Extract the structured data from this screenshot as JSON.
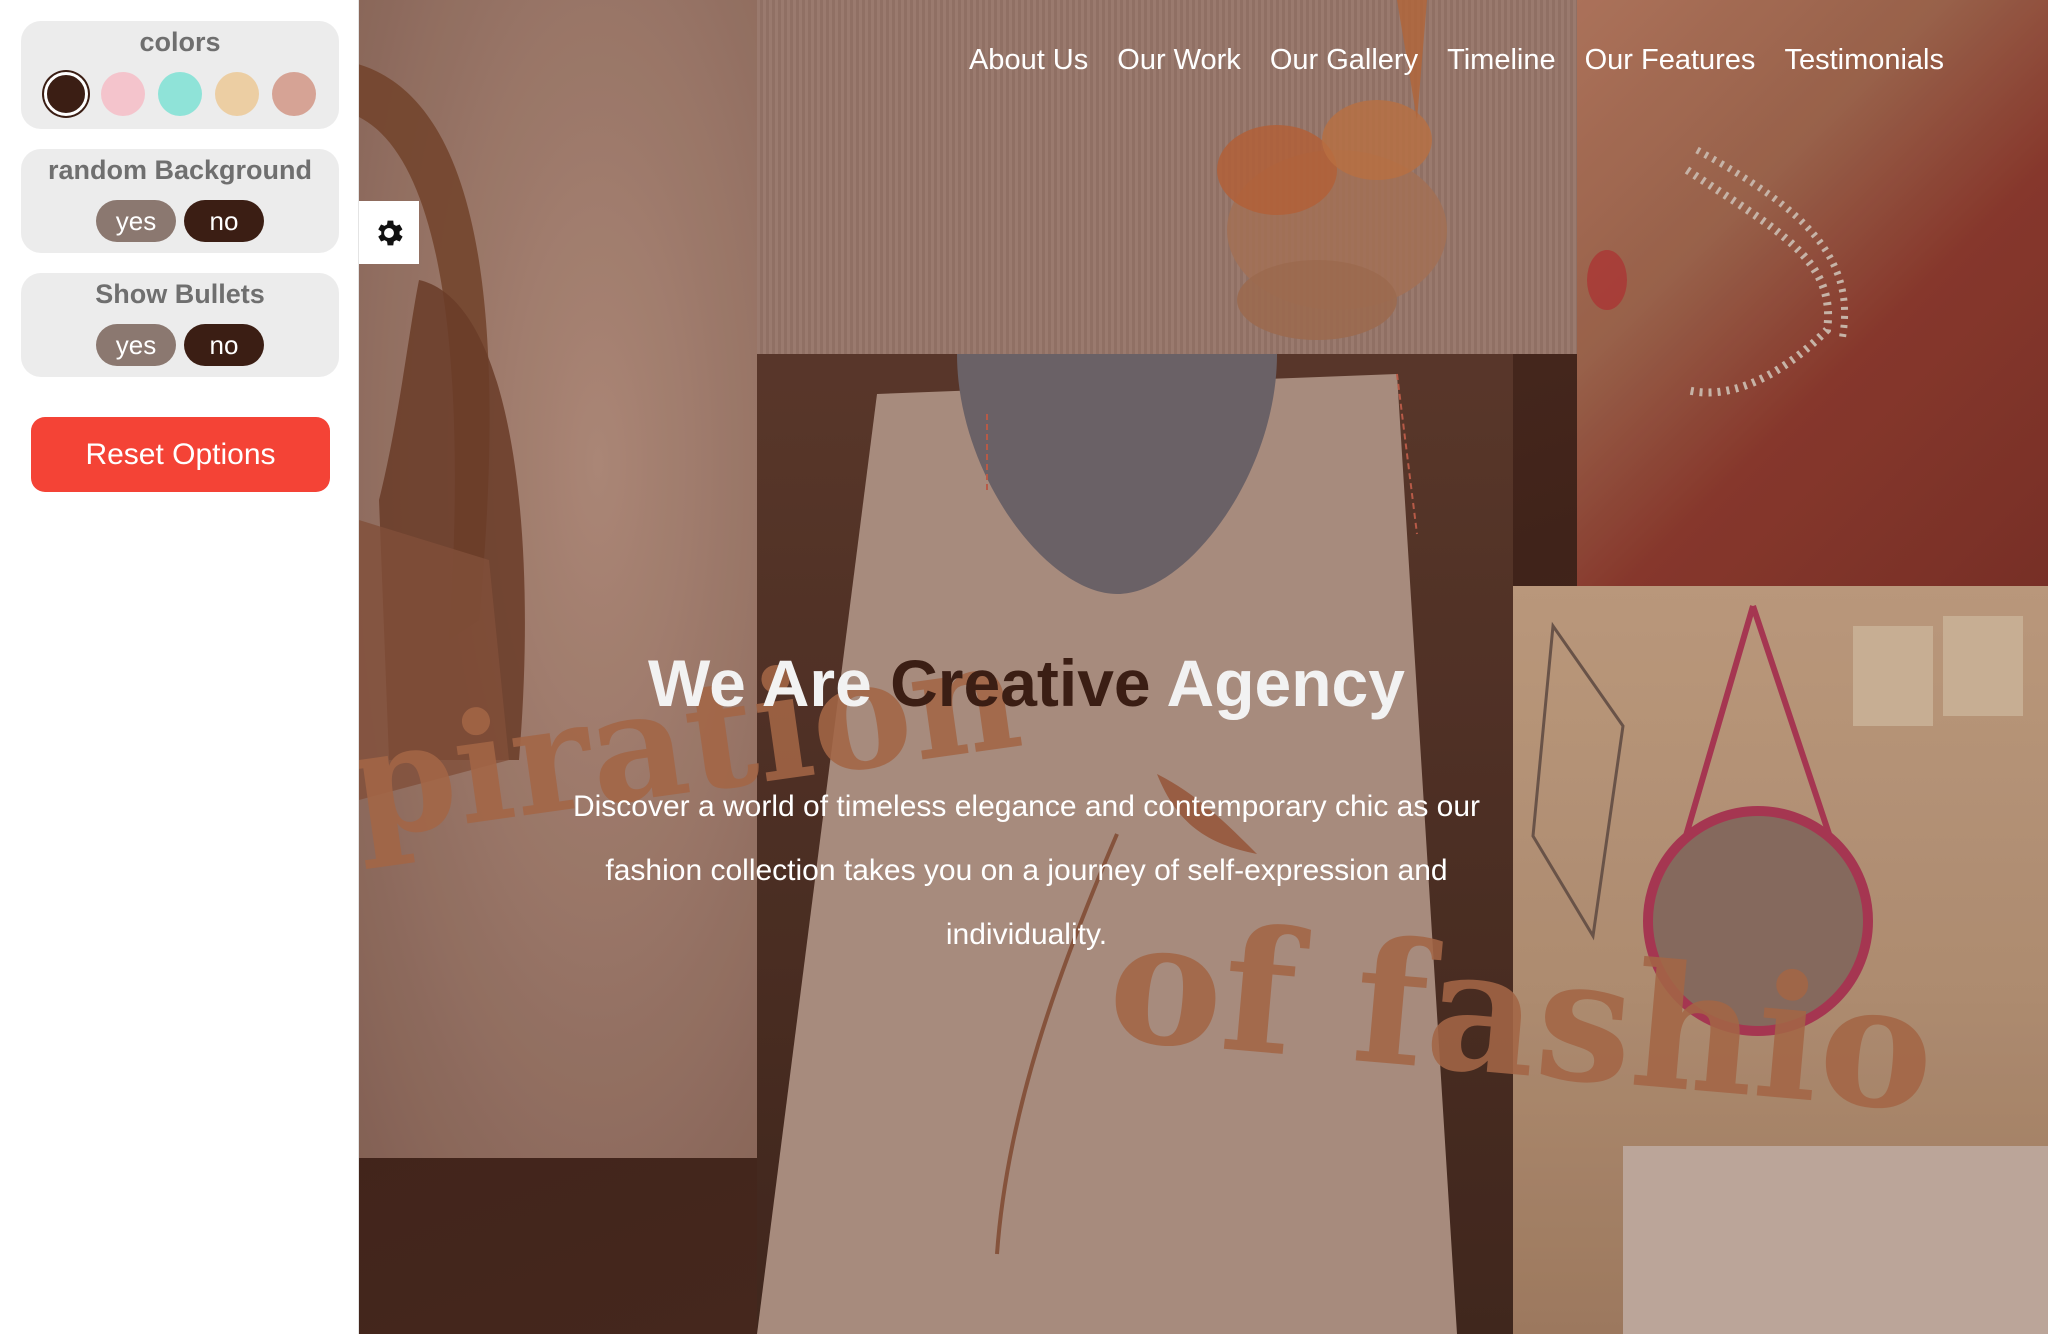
{
  "settings": {
    "colors_title": "colors",
    "swatches": [
      "#3b1e14",
      "#f4c4cc",
      "#8fe3d8",
      "#eccea3",
      "#d6a395"
    ],
    "random_bg_title": "random Background",
    "show_bullets_title": "Show Bullets",
    "yes_label": "yes",
    "no_label": "no",
    "reset_label": "Reset Options",
    "gear_icon": "gear-icon"
  },
  "nav": {
    "items": [
      "About Us",
      "Our Work",
      "Our Gallery",
      "Timeline",
      "Our Features",
      "Testimonials"
    ]
  },
  "hero": {
    "title_start": "We Are ",
    "title_accent": "Creative",
    "title_end": " Agency",
    "description": "Discover a world of timeless elegance and contemporary chic as our fashion collection takes you on a journey of self-expression and individuality.",
    "deco_text_1": "piration",
    "deco_text_2": "of fashio"
  },
  "colors": {
    "accent": "#3b1e14",
    "reset": "#f44336"
  }
}
